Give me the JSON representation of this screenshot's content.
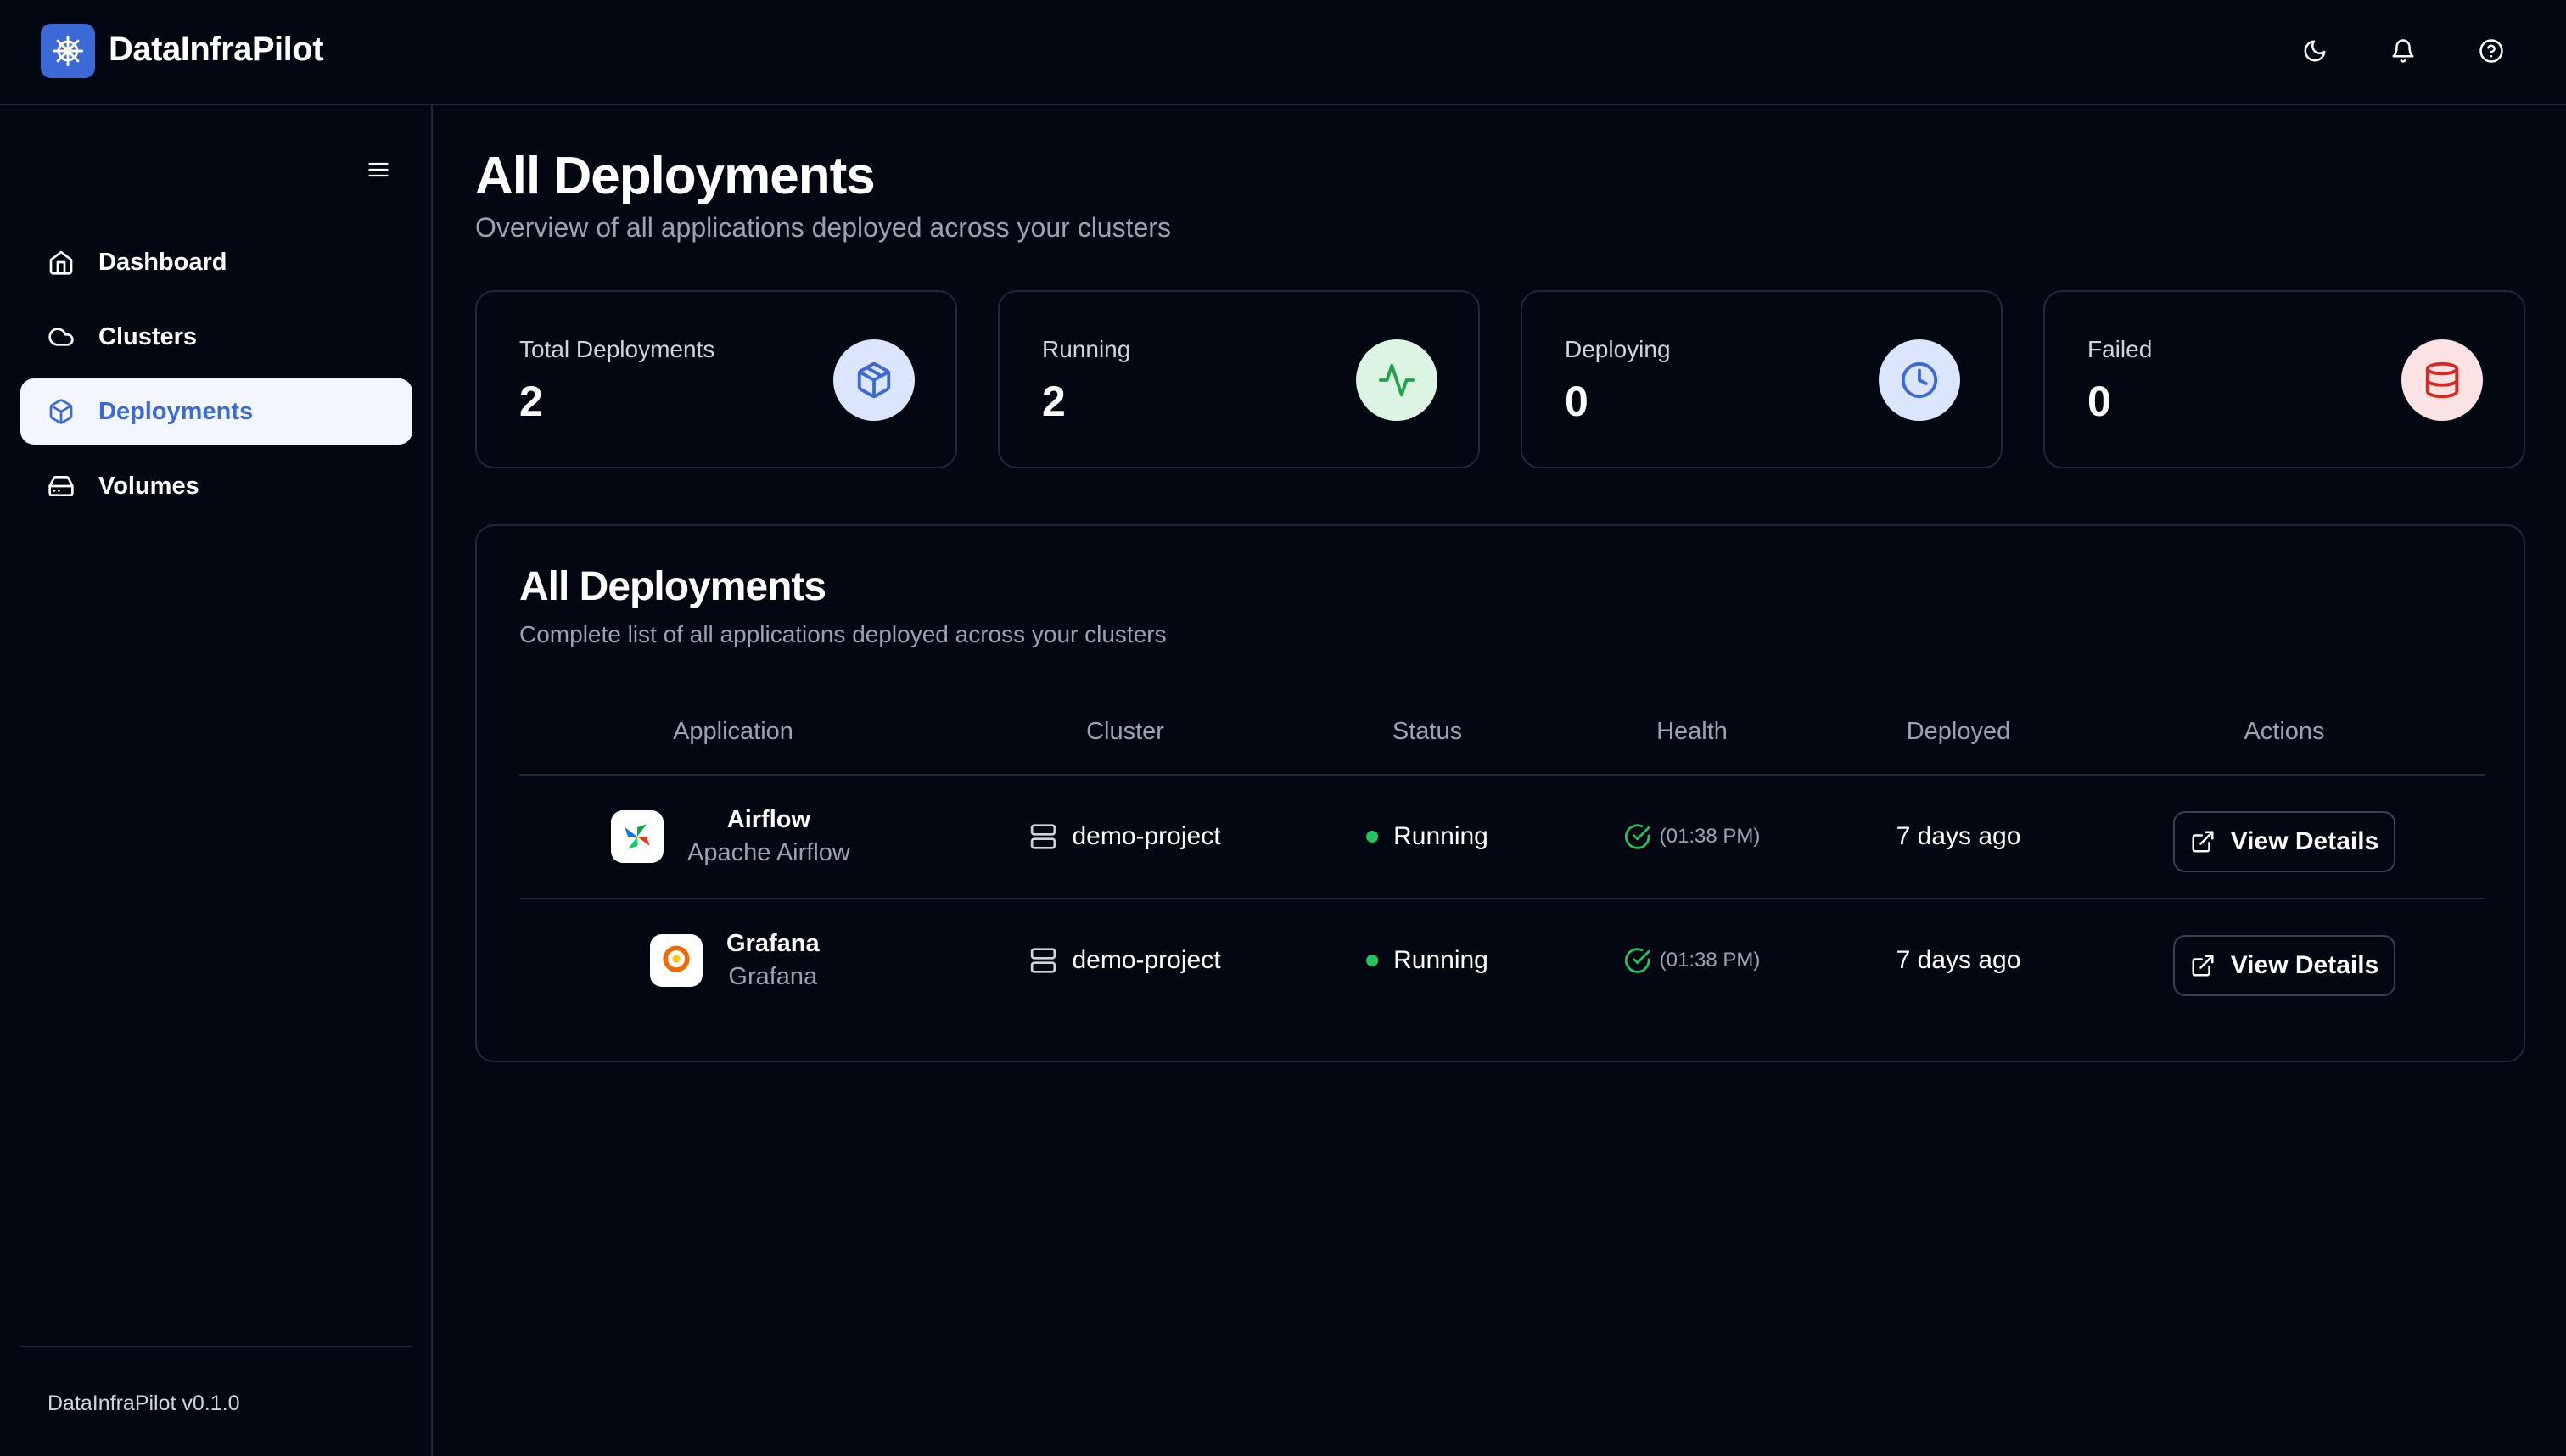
{
  "app": {
    "brand": "DataInfraPilot",
    "version": "DataInfraPilot v0.1.0"
  },
  "header": {
    "icons": [
      "moon-icon",
      "bell-icon",
      "help-circle-icon"
    ]
  },
  "sidebar": {
    "items": [
      {
        "label": "Dashboard",
        "icon": "home-icon",
        "active": false
      },
      {
        "label": "Clusters",
        "icon": "cloud-icon",
        "active": false
      },
      {
        "label": "Deployments",
        "icon": "package-icon",
        "active": true
      },
      {
        "label": "Volumes",
        "icon": "hard-drive-icon",
        "active": false
      }
    ]
  },
  "main": {
    "title": "All Deployments",
    "subtitle": "Overview of all applications deployed across your clusters",
    "stats": [
      {
        "label": "Total Deployments",
        "value": "2",
        "icon": "package-icon",
        "color": "#3b6ad6"
      },
      {
        "label": "Running",
        "value": "2",
        "icon": "activity-icon",
        "color": "#22a34a"
      },
      {
        "label": "Deploying",
        "value": "0",
        "icon": "clock-icon",
        "color": "#3b6ad6"
      },
      {
        "label": "Failed",
        "value": "0",
        "icon": "database-icon",
        "color": "#dc2626"
      }
    ],
    "table": {
      "title": "All Deployments",
      "subtitle": "Complete list of all applications deployed across your clusters",
      "headers": [
        "Application",
        "Cluster",
        "Status",
        "Health",
        "Deployed",
        "Actions"
      ],
      "rows": [
        {
          "name": "Airflow",
          "sub": "Apache Airflow",
          "logo": "airflow-logo",
          "cluster": "demo-project",
          "status": "Running",
          "health_time": "(01:38 PM)",
          "deployed": "7 days ago",
          "action": "View Details"
        },
        {
          "name": "Grafana",
          "sub": "Grafana",
          "logo": "grafana-logo",
          "cluster": "demo-project",
          "status": "Running",
          "health_time": "(01:38 PM)",
          "deployed": "7 days ago",
          "action": "View Details"
        }
      ]
    }
  },
  "colors": {
    "background": "#030712",
    "border": "#1f2937",
    "accent": "#3b6ad6",
    "success": "#22c55e",
    "muted": "#9ca3af"
  }
}
